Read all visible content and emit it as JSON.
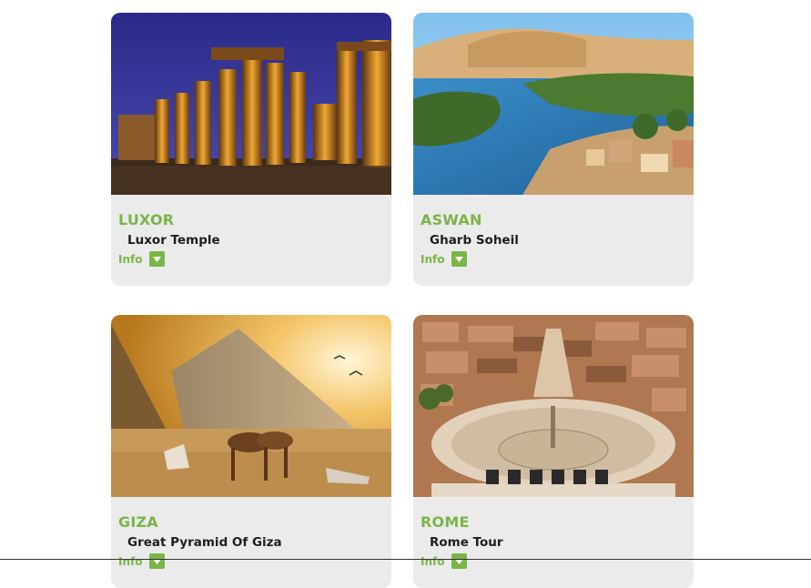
{
  "cards": [
    {
      "city": "LUXOR",
      "tour": "Luxor Temple",
      "info_label": "Info"
    },
    {
      "city": "ASWAN",
      "tour": "Gharb Soheil",
      "info_label": "Info"
    },
    {
      "city": "GIZA",
      "tour": "Great Pyramid Of Giza",
      "info_label": "Info"
    },
    {
      "city": "ROME",
      "tour": "Rome Tour",
      "info_label": "Info"
    }
  ],
  "colors": {
    "accent": "#7ab547",
    "card_background": "#ebebeb",
    "title_text": "#1e1e1e"
  },
  "icons": {
    "info_toggle": "caret-down-icon"
  }
}
